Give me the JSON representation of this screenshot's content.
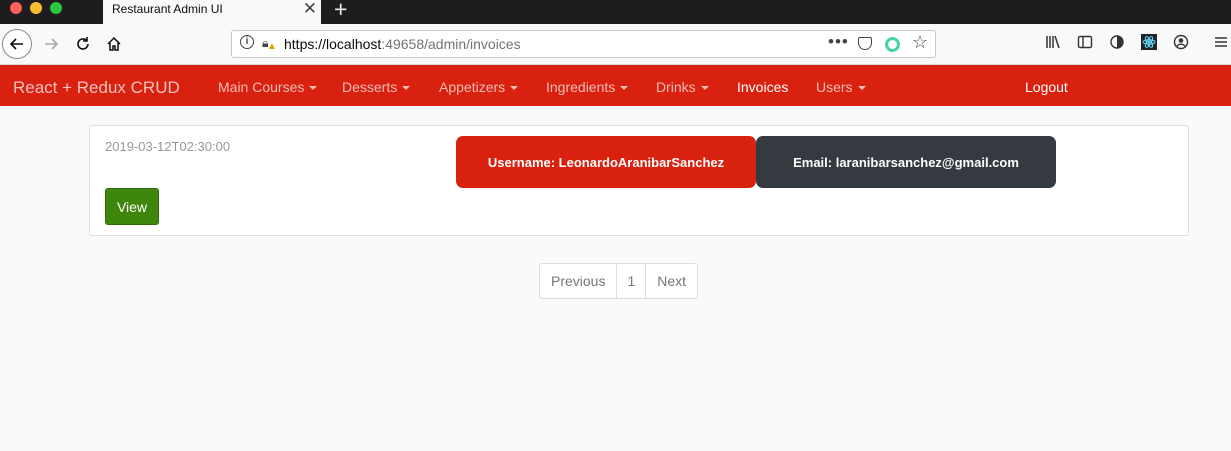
{
  "browser": {
    "tab_title": "Restaurant Admin UI",
    "tab_close": "✕",
    "new_tab": "+",
    "url_host": "https://localhost",
    "url_path": ":49658/admin/invoices",
    "more_dots": "•••"
  },
  "app": {
    "brand": "React + Redux CRUD",
    "menu": [
      {
        "label": "Main Courses",
        "dropdown": true
      },
      {
        "label": "Desserts",
        "dropdown": true
      },
      {
        "label": "Appetizers",
        "dropdown": true
      },
      {
        "label": "Ingredients",
        "dropdown": true
      },
      {
        "label": "Drinks",
        "dropdown": true
      },
      {
        "label": "Invoices",
        "dropdown": false,
        "active": true
      },
      {
        "label": "Users",
        "dropdown": true
      }
    ],
    "logout": "Logout",
    "colors": {
      "navbar": "#d8210f",
      "view_button": "#3f870c",
      "email_pill": "#343a40"
    }
  },
  "invoice": {
    "date": "2019-03-12T02:30:00",
    "view_label": "View",
    "username_label": "Username: LeonardoAranibarSanchez",
    "email_label": "Email: laranibarsanchez@gmail.com"
  },
  "pagination": {
    "previous": "Previous",
    "page": "1",
    "next": "Next"
  }
}
